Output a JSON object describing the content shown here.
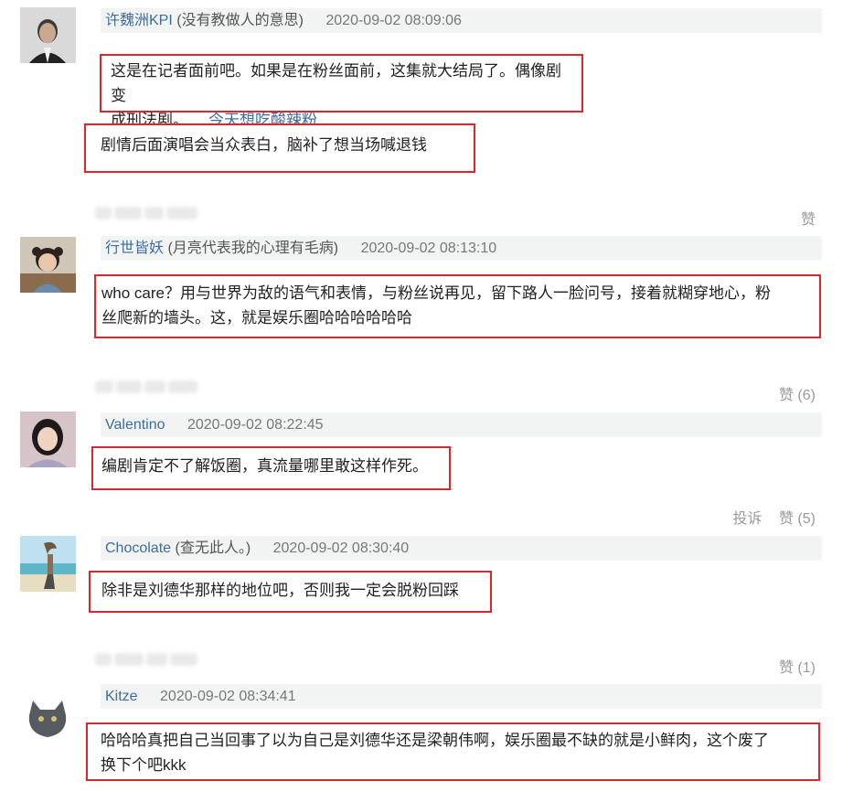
{
  "comments": [
    {
      "username": "许魏洲KPI",
      "remark": "(没有教做人的意思)",
      "time": "2020-09-02 08:09:06",
      "quote_line1": "这是在记者面前吧。如果是在粉丝面前，这集就大结局了。偶像剧变",
      "quote_line2": "成刑法剧。",
      "quote_author": "今天想吃酸辣粉",
      "text": "剧情后面演唱会当众表白，脑补了想当场喊退钱",
      "like": "赞"
    },
    {
      "username": "行世皆妖",
      "remark": "(月亮代表我的心理有毛病)",
      "time": "2020-09-02 08:13:10",
      "text_line1": "who care？用与世界为敌的语气和表情，与粉丝说再见，留下路人一脸问号，接着就糊穿地心，粉",
      "text_line2": "丝爬新的墙头。这，就是娱乐圈哈哈哈哈哈哈",
      "like": "赞 (6)"
    },
    {
      "username": "Valentino",
      "time": "2020-09-02 08:22:45",
      "text": "编剧肯定不了解饭圈，真流量哪里敢这样作死。",
      "report": "投诉",
      "like": "赞 (5)"
    },
    {
      "username": "Chocolate",
      "remark": "(查无此人。)",
      "time": "2020-09-02 08:30:40",
      "text": "除非是刘德华那样的地位吧，否则我一定会脱粉回踩",
      "like": "赞 (1)"
    },
    {
      "username": "Kitze",
      "time": "2020-09-02 08:34:41",
      "text_line1": "哈哈哈真把自己当回事了以为自己是刘德华还是梁朝伟啊，娱乐圈最不缺的就是小鲜肉，这个废了",
      "text_line2": "换下个吧kkk"
    }
  ]
}
